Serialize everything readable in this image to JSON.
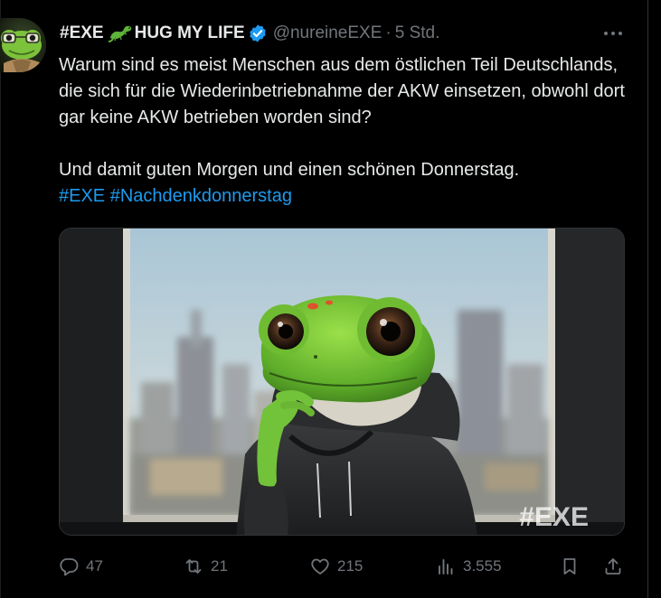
{
  "tweet": {
    "author": {
      "display_name_prefix": "#EXE",
      "display_name_suffix": "HUG MY LIFE",
      "emoji_icon": "lizard-emoji-icon",
      "verified_icon": "verified-badge-icon",
      "handle": "@nureineEXE",
      "separator": "·",
      "time": "5 Std."
    },
    "text": {
      "line1": "Warum sind es meist Menschen aus dem östlichen Teil Deutschlands, die sich für die Wiederinbetriebnahme der AKW einsetzen, obwohl dort gar keine AKW betrieben worden sind?",
      "line2": "Und damit guten Morgen und einen schönen Donnerstag.",
      "hashtags": [
        "#EXE",
        "#Nachdenkdonnerstag"
      ]
    },
    "media": {
      "watermark": "#EXE"
    },
    "actions": {
      "replies": "47",
      "retweets": "21",
      "likes": "215",
      "views": "3.555"
    }
  },
  "colors": {
    "background": "#000000",
    "text": "#e7e9ea",
    "secondary": "#71767b",
    "link": "#1d9bf0",
    "verified": "#1d9bf0"
  }
}
